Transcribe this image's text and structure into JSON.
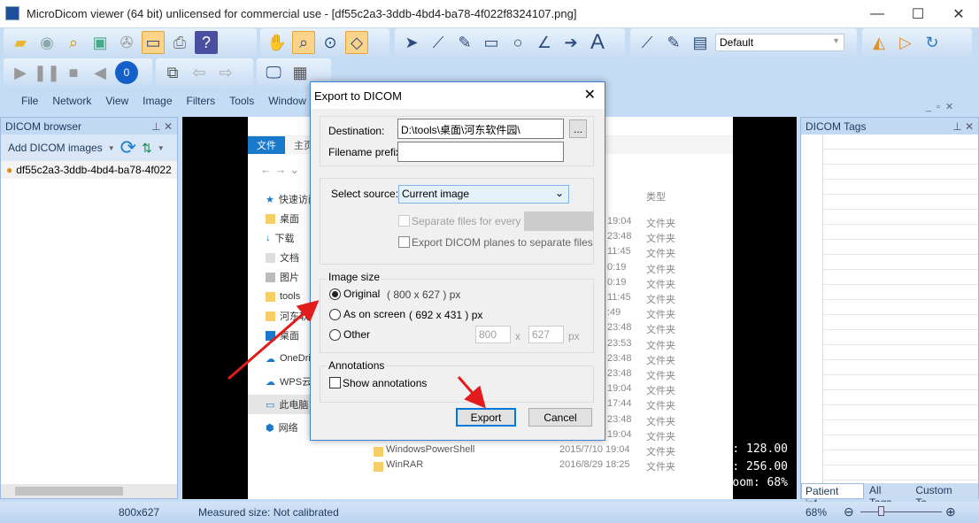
{
  "window": {
    "title": "MicroDicom viewer (64 bit) unlicensed for commercial use - [df55c2a3-3ddb-4bd4-ba78-4f022f8324107.png]",
    "minimize": "—",
    "maximize": "☐",
    "close": "✕"
  },
  "toolbar": {
    "annotation_preset": "Default"
  },
  "menu": [
    "File",
    "Network",
    "View",
    "Image",
    "Filters",
    "Tools",
    "Window"
  ],
  "browser": {
    "title": "DICOM browser",
    "add_label": "Add DICOM images",
    "item": "df55c2a3-3ddb-4bd4-ba78-4f022f",
    "pin": "⊥",
    "close": "✕"
  },
  "tags_panel": {
    "title": "DICOM Tags",
    "tabs": [
      "Patient inf...",
      "All Tags",
      "Custom Ta..."
    ]
  },
  "overlay": {
    "line1": ": 128.00",
    "line2": ": 256.00",
    "line3": "oom: 68%"
  },
  "explorer": {
    "ribbon_tabs": [
      "文件",
      "主页"
    ],
    "column_type": "类型",
    "nav": [
      "快速访问",
      "桌面",
      "下载",
      "文档",
      "图片",
      "tools",
      "河东软",
      "桌面",
      "OneDriv",
      "WPS云文",
      "此电脑",
      "网络"
    ],
    "times": [
      "19:04",
      "23:48",
      "11:45",
      "0:19",
      "0:19",
      "11:45",
      ":49",
      "23:48",
      "23:53",
      "23:48",
      "23:48",
      "19:04",
      "17:44",
      "23:48",
      "19:04"
    ],
    "type_value": "文件夹",
    "files": [
      {
        "name": "WindowsPowerShell",
        "date": "2015/7/10 19:04",
        "type": "文件夹"
      },
      {
        "name": "WinRAR",
        "date": "2016/8/29 18:25",
        "type": "文件夹"
      }
    ]
  },
  "status": {
    "dims": "800x627",
    "measured": "Measured size: Not calibrated",
    "zoom": "68%",
    "zoom_level": 0.25
  },
  "dialog": {
    "title": "Export to DICOM",
    "destination_label": "Destination:",
    "destination_value": "D:\\tools\\桌面\\河东软件园\\",
    "browse": "...",
    "prefix_label": "Filename prefix:",
    "prefix_value": "",
    "source_label": "Select source:",
    "source_value": "Current image",
    "separate_every": "Separate files for every",
    "separate_planes": "Export DICOM planes to separate files",
    "image_size_title": "Image size",
    "original": "Original",
    "original_size": "( 800 x 627 ) px",
    "screen": "As on screen",
    "screen_size": "( 692 x 431 ) px",
    "other": "Other",
    "other_w": "800",
    "x": "x",
    "other_h": "627",
    "px": "px",
    "annotations_title": "Annotations",
    "show_annotations": "Show annotations",
    "export": "Export",
    "cancel": "Cancel"
  }
}
